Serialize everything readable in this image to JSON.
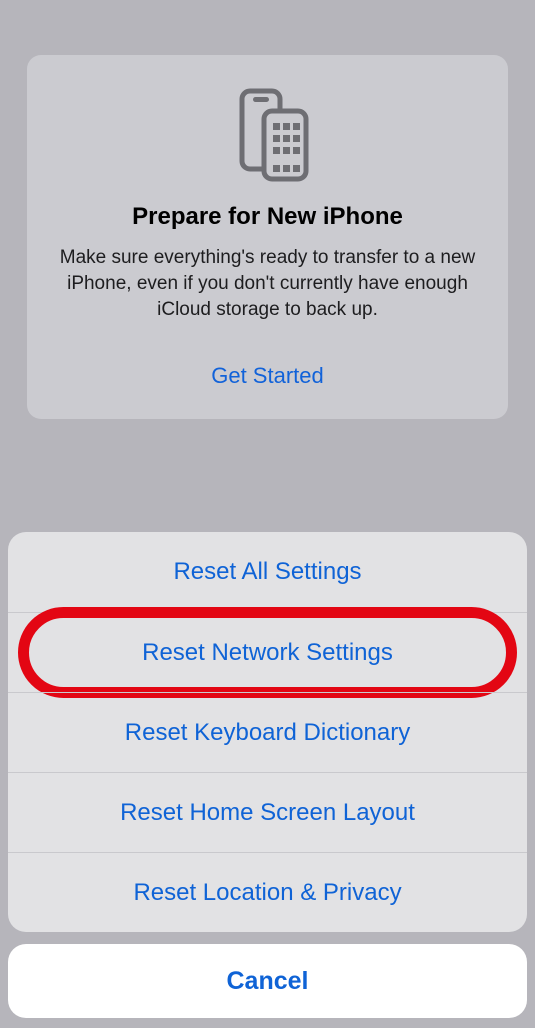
{
  "promo": {
    "title": "Prepare for New iPhone",
    "description": "Make sure everything's ready to transfer to a new iPhone, even if you don't currently have enough iCloud storage to back up.",
    "cta": "Get Started"
  },
  "sheet": {
    "items": [
      {
        "label": "Reset All Settings"
      },
      {
        "label": "Reset Network Settings",
        "highlighted": true
      },
      {
        "label": "Reset Keyboard Dictionary"
      },
      {
        "label": "Reset Home Screen Layout"
      },
      {
        "label": "Reset Location & Privacy"
      }
    ],
    "cancel_label": "Cancel"
  },
  "colors": {
    "accent": "#0f63d6",
    "highlight_ring": "#e30613"
  }
}
